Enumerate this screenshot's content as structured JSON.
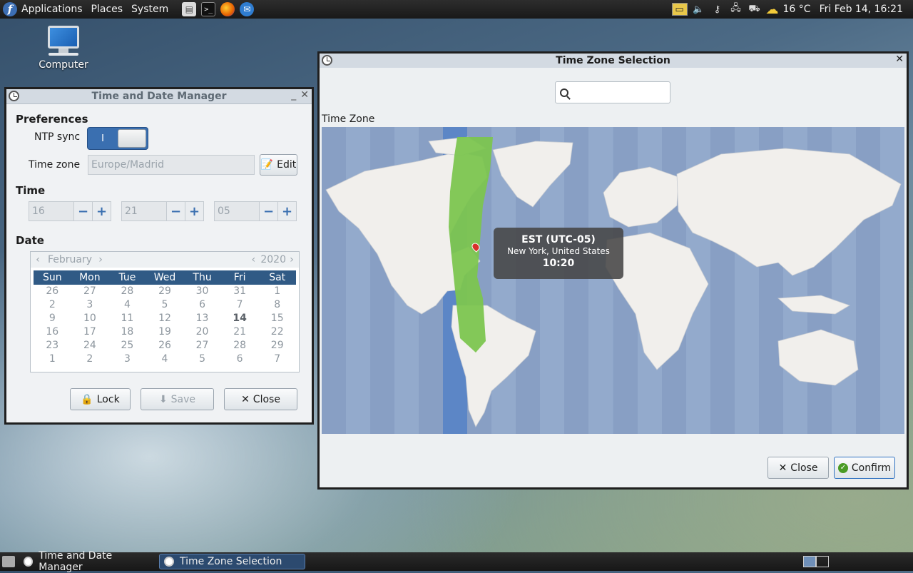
{
  "top_panel": {
    "menus": [
      "Applications",
      "Places",
      "System"
    ],
    "temperature": "16 °C",
    "clock": "Fri Feb 14, 16:21"
  },
  "desktop": {
    "computer_label": "Computer"
  },
  "tdm": {
    "title": "Time and Date Manager",
    "preferences_label": "Preferences",
    "ntp_label": "NTP sync",
    "ntp_toggle_text": "I",
    "timezone_label": "Time zone",
    "timezone_value": "Europe/Madrid",
    "edit_label": "Edit",
    "time_label": "Time",
    "hour": "16",
    "minute": "21",
    "second": "05",
    "date_label": "Date",
    "month": "February",
    "year": "2020",
    "weekdays": [
      "Sun",
      "Mon",
      "Tue",
      "Wed",
      "Thu",
      "Fri",
      "Sat"
    ],
    "days": [
      "26",
      "27",
      "28",
      "29",
      "30",
      "31",
      "1",
      "2",
      "3",
      "4",
      "5",
      "6",
      "7",
      "8",
      "9",
      "10",
      "11",
      "12",
      "13",
      "14",
      "15",
      "16",
      "17",
      "18",
      "19",
      "20",
      "21",
      "22",
      "23",
      "24",
      "25",
      "26",
      "27",
      "28",
      "29",
      "1",
      "2",
      "3",
      "4",
      "5",
      "6",
      "7"
    ],
    "today": "14",
    "lock_label": "Lock",
    "save_label": "Save",
    "close_label": "Close"
  },
  "tzs": {
    "title": "Time Zone Selection",
    "section_label": "Time Zone",
    "tooltip_zone": "EST (UTC-05)",
    "tooltip_city": "New York, United States",
    "tooltip_time": "10:20",
    "close_label": "Close",
    "confirm_label": "Confirm"
  },
  "taskbar": {
    "tasks": [
      "Time and Date Manager",
      "Time Zone Selection"
    ]
  },
  "colors": {
    "ocean": "#8ea6ca",
    "land": "#f1efec",
    "selected_zone": "#7cc550",
    "accent": "#3a6fb0"
  }
}
